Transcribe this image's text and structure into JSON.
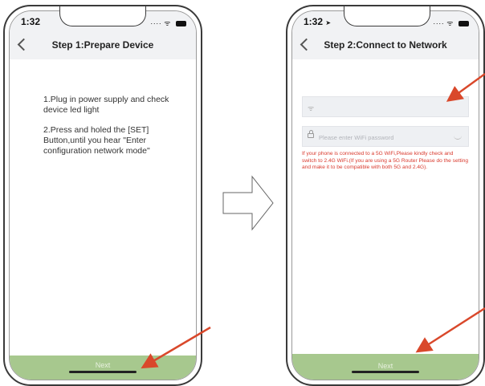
{
  "screen_left": {
    "time": "1:32",
    "title": "Step 1:Prepare Device",
    "instructions": [
      "1.Plug in power supply and check device led light",
      "2.Press and holed the [SET] Button,until you hear \"Enter configuration network mode\""
    ],
    "next_label": "Next"
  },
  "screen_right": {
    "time": "1:32",
    "title": "Step 2:Connect to Network",
    "password_placeholder": "Please enter WiFi password",
    "warning": "If your phone is connected to a 5G WiFi,Please kindly check and switch to 2.4G WiFi.(If you are using a 5G Router Please do the setting and make it to be compatible with both 5G and 2.4G).",
    "next_label": "Next"
  },
  "colors": {
    "next_button": "#a7c88e",
    "annotation_arrow": "#d9482b",
    "warning_text": "#d9392d"
  }
}
